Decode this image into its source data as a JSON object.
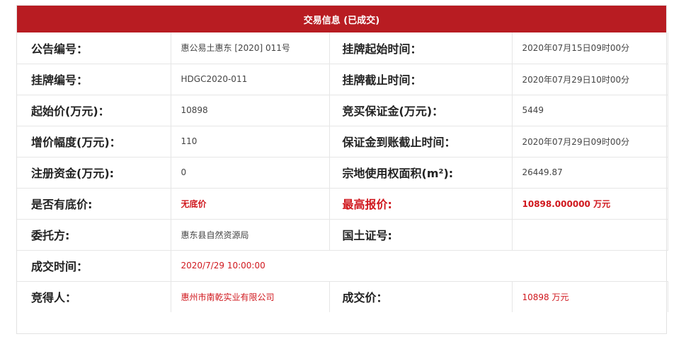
{
  "header": {
    "title": "交易信息 (已成交)"
  },
  "rows": [
    {
      "l1": "公告编号：",
      "v1": "惠公易土惠东 [2020] 011号",
      "l2": "挂牌起始时间：",
      "v2": "2020年07月15日09时00分"
    },
    {
      "l1": "挂牌编号：",
      "v1": "HDGC2020-011",
      "l2": "挂牌截止时间：",
      "v2": "2020年07月29日10时00分"
    },
    {
      "l1": "起始价(万元)：",
      "v1": "10898",
      "l2": "竞买保证金(万元)：",
      "v2": "5449"
    },
    {
      "l1": "增价幅度(万元)：",
      "v1": "110",
      "l2": "保证金到账截止时间：",
      "v2": "2020年07月29日09时00分"
    },
    {
      "l1": "注册资金(万元):",
      "v1": "0",
      "l2": "宗地使用权面积(m²):",
      "v2": "26449.87"
    },
    {
      "l1": "是否有底价:",
      "v1": "无底价",
      "l2": "最高报价:",
      "v2": "10898.000000 万元"
    },
    {
      "l1": "委托方:",
      "v1": "惠东县自然资源局",
      "l2": "国土证号:",
      "v2": ""
    },
    {
      "l1": "成交时间：",
      "v1": "2020/7/29 10:00:00"
    },
    {
      "l1": "竞得人：",
      "v1": "惠州市南乾实业有限公司",
      "l2": "成交价：",
      "v2": "10898 万元"
    }
  ],
  "colors": {
    "header_bg": "#b81c22",
    "accent_red": "#d0181e"
  }
}
